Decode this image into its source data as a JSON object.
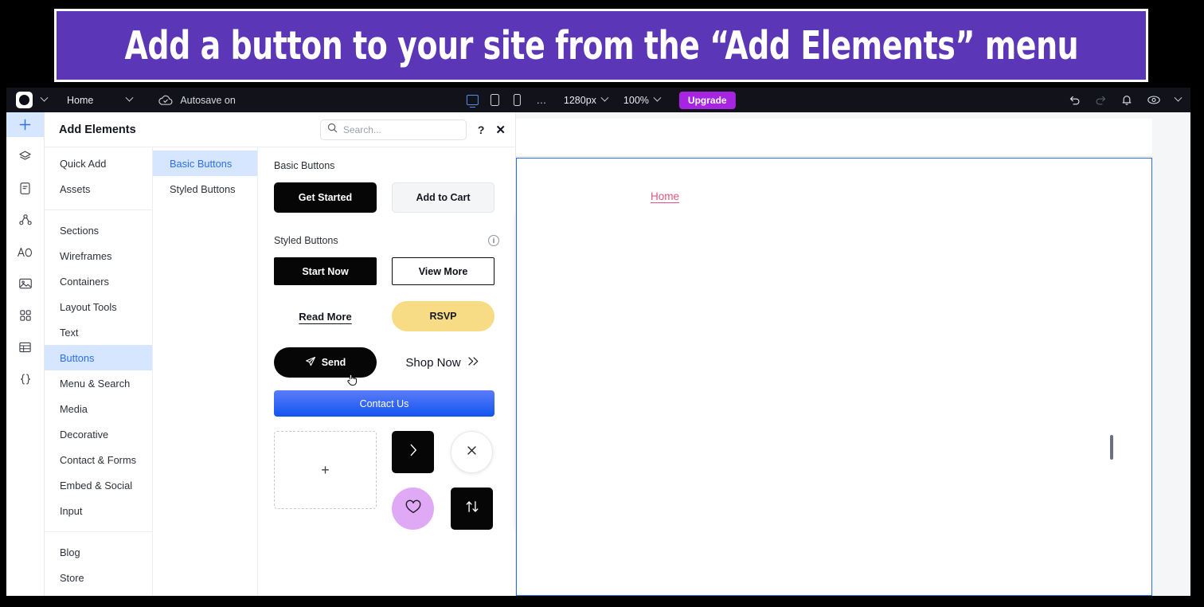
{
  "banner": {
    "text": "Add a button to your site from the “Add Elements” menu",
    "bg": "#5B36B7",
    "color": "#FFFFFF"
  },
  "topbar": {
    "logo_icon": "site-logo-icon",
    "logo_chevron_icon": "chevron-down-icon",
    "page_name": "Home",
    "page_chevron_icon": "chevron-down-icon",
    "autosave_icon": "cloud-check-icon",
    "autosave_label": "Autosave on",
    "viewport_desktop_icon": "desktop-icon",
    "viewport_tablet_icon": "tablet-icon",
    "viewport_mobile_icon": "mobile-icon",
    "more_label": "…",
    "width_value": "1280px",
    "width_chevron_icon": "chevron-down-icon",
    "zoom_value": "100%",
    "zoom_chevron_icon": "chevron-down-icon",
    "upgrade_label": "Upgrade",
    "undo_icon": "undo-icon",
    "redo_icon": "redo-icon",
    "notifications_icon": "bell-icon",
    "preview_icon": "eye-icon",
    "preview_chevron_icon": "chevron-down-icon",
    "accent_upgrade": "#A625E0",
    "bg": "#12131A"
  },
  "rail": {
    "items": [
      {
        "icon": "plus-icon",
        "name": "add-elements",
        "active": true
      },
      {
        "icon": "layers-icon",
        "name": "layers",
        "active": false
      },
      {
        "icon": "pages-icon",
        "name": "pages",
        "active": false
      },
      {
        "icon": "site-structure-icon",
        "name": "site-structure",
        "active": false
      },
      {
        "icon": "theme-text-icon",
        "name": "theme",
        "active": false
      },
      {
        "icon": "media-image-icon",
        "name": "media",
        "active": false
      },
      {
        "icon": "apps-grid-icon",
        "name": "apps",
        "active": false
      },
      {
        "icon": "table-cms-icon",
        "name": "cms",
        "active": false
      },
      {
        "icon": "code-braces-icon",
        "name": "code",
        "active": false
      }
    ]
  },
  "panel": {
    "title": "Add Elements",
    "search": {
      "placeholder": "Search...",
      "value": "",
      "icon": "search-icon"
    },
    "help_label": "?",
    "close_label": "✕",
    "categories": [
      {
        "label": "Quick Add",
        "active": false
      },
      {
        "label": "Assets",
        "active": false
      },
      {
        "divider": true
      },
      {
        "label": "Sections",
        "active": false
      },
      {
        "label": "Wireframes",
        "active": false
      },
      {
        "label": "Containers",
        "active": false
      },
      {
        "label": "Layout Tools",
        "active": false
      },
      {
        "label": "Text",
        "active": false
      },
      {
        "label": "Buttons",
        "active": true
      },
      {
        "label": "Menu & Search",
        "active": false
      },
      {
        "label": "Media",
        "active": false
      },
      {
        "label": "Decorative",
        "active": false
      },
      {
        "label": "Contact & Forms",
        "active": false
      },
      {
        "label": "Embed & Social",
        "active": false
      },
      {
        "label": "Input",
        "active": false
      },
      {
        "divider": true
      },
      {
        "label": "Blog",
        "active": false
      },
      {
        "label": "Store",
        "active": false
      }
    ],
    "subcategories": [
      {
        "label": "Basic Buttons",
        "active": true
      },
      {
        "label": "Styled Buttons",
        "active": false
      }
    ]
  },
  "gallery": {
    "basic_heading": "Basic Buttons",
    "basic": [
      {
        "label": "Get Started",
        "style": "solid-black"
      },
      {
        "label": "Add to Cart",
        "style": "light-gray"
      }
    ],
    "styled_heading": "Styled Buttons",
    "styled_info_icon": "info-icon",
    "styled": [
      {
        "label": "Start Now",
        "style": "square-black"
      },
      {
        "label": "View More",
        "style": "square-outline"
      },
      {
        "label": "Read More",
        "style": "underlined-link"
      },
      {
        "label": "RSVP",
        "style": "pill-yellow",
        "color": "#F8DC85"
      },
      {
        "label": "Send",
        "style": "pill-black-with-icon",
        "icon": "paper-plane-icon"
      },
      {
        "label": "Shop Now",
        "style": "text-arrow",
        "icon": "double-chevron-right-icon"
      },
      {
        "label": "Contact Us",
        "style": "wide-blue-gradient",
        "color": "#1155F0"
      }
    ],
    "extras": [
      {
        "name": "placeholder-add-box",
        "icon": "plus-icon",
        "label": "+"
      },
      {
        "name": "chevron-button",
        "icon": "chevron-right-icon",
        "label": "›"
      },
      {
        "name": "close-button",
        "icon": "close-x-icon",
        "label": "✕"
      },
      {
        "name": "favorite-button",
        "icon": "heart-icon",
        "label": "♡"
      },
      {
        "name": "sort-button",
        "icon": "arrows-up-down-icon",
        "label": "⇅"
      }
    ],
    "cursor_icon": "hand-pointer-cursor"
  },
  "canvas": {
    "home_link_label": "Home",
    "home_link_color": "#E0557E",
    "selection_color": "#2B6FEE"
  }
}
